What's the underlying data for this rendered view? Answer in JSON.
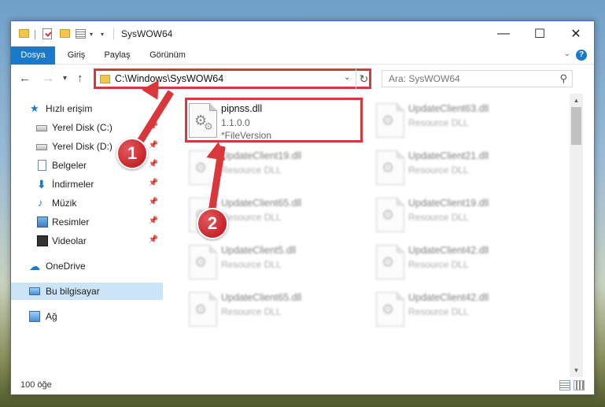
{
  "window": {
    "title": "SysWOW64"
  },
  "ribbon": {
    "tabs": [
      "Dosya",
      "Giriş",
      "Paylaş",
      "Görünüm"
    ],
    "help": "?"
  },
  "nav": {
    "back": "←",
    "forward": "→",
    "recent": "▾",
    "up": "↑",
    "address": "C:\\Windows\\SysWOW64",
    "search_placeholder": "Ara: SysWOW64"
  },
  "sidebar": {
    "items": [
      {
        "label": "Hızlı erişim",
        "icon": "star-icon",
        "pinned": false
      },
      {
        "label": "Yerel Disk (C:)",
        "icon": "drive-icon",
        "pinned": true
      },
      {
        "label": "Yerel Disk (D:)",
        "icon": "drive-icon",
        "pinned": true
      },
      {
        "label": "Belgeler",
        "icon": "documents-icon",
        "pinned": true
      },
      {
        "label": "İndirmeler",
        "icon": "downloads-icon",
        "pinned": true
      },
      {
        "label": "Müzik",
        "icon": "music-icon",
        "pinned": true
      },
      {
        "label": "Resimler",
        "icon": "pictures-icon",
        "pinned": true
      },
      {
        "label": "Videolar",
        "icon": "videos-icon",
        "pinned": true
      },
      {
        "label": "OneDrive",
        "icon": "onedrive-icon",
        "pinned": false
      },
      {
        "label": "Bu bilgisayar",
        "icon": "computer-icon",
        "pinned": false,
        "selected": true
      },
      {
        "label": "Ağ",
        "icon": "network-icon",
        "pinned": false
      }
    ]
  },
  "files": [
    {
      "name": "pipnss.dll",
      "line2": "1.1.0.0",
      "line3": "*FileVersion",
      "highlighted": true
    },
    {
      "name": "UpdateClient63.dll",
      "line2": "Resource DLL"
    },
    {
      "name": "UpdateClient19.dll",
      "line2": "Resource DLL"
    },
    {
      "name": "UpdateClient21.dll",
      "line2": "Resource DLL"
    },
    {
      "name": "UpdateClient65.dll",
      "line2": "Resource DLL"
    },
    {
      "name": "UpdateClient19.dll",
      "line2": "Resource DLL"
    },
    {
      "name": "UpdateClient5.dll",
      "line2": "Resource DLL"
    },
    {
      "name": "UpdateClient42.dll",
      "line2": "Resource DLL"
    },
    {
      "name": "UpdateClient65.dll",
      "line2": "Resource DLL"
    },
    {
      "name": "UpdateClient42.dll",
      "line2": "Resource DLL"
    }
  ],
  "status": {
    "count": "100 öğe"
  },
  "annotations": {
    "step1": "1",
    "step2": "2",
    "color": "#d9373c"
  }
}
